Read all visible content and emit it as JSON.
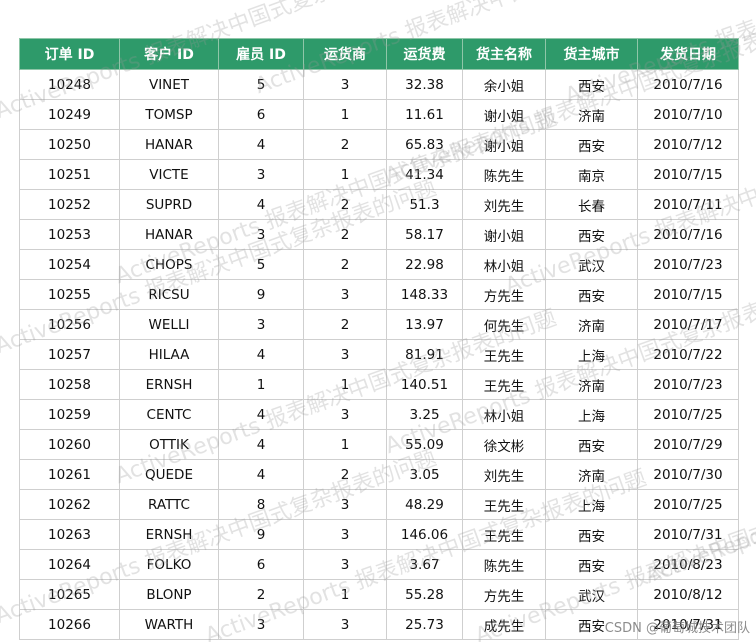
{
  "table": {
    "headers": [
      "订单 ID",
      "客户 ID",
      "雇员 ID",
      "运货商",
      "运货费",
      "货主名称",
      "货主城市",
      "发货日期"
    ],
    "rows": [
      [
        "10248",
        "VINET",
        "5",
        "3",
        "32.38",
        "余小姐",
        "西安",
        "2010/7/16"
      ],
      [
        "10249",
        "TOMSP",
        "6",
        "1",
        "11.61",
        "谢小姐",
        "济南",
        "2010/7/10"
      ],
      [
        "10250",
        "HANAR",
        "4",
        "2",
        "65.83",
        "谢小姐",
        "西安",
        "2010/7/12"
      ],
      [
        "10251",
        "VICTE",
        "3",
        "1",
        "41.34",
        "陈先生",
        "南京",
        "2010/7/15"
      ],
      [
        "10252",
        "SUPRD",
        "4",
        "2",
        "51.3",
        "刘先生",
        "长春",
        "2010/7/11"
      ],
      [
        "10253",
        "HANAR",
        "3",
        "2",
        "58.17",
        "谢小姐",
        "西安",
        "2010/7/16"
      ],
      [
        "10254",
        "CHOPS",
        "5",
        "2",
        "22.98",
        "林小姐",
        "武汉",
        "2010/7/23"
      ],
      [
        "10255",
        "RICSU",
        "9",
        "3",
        "148.33",
        "方先生",
        "西安",
        "2010/7/15"
      ],
      [
        "10256",
        "WELLI",
        "3",
        "2",
        "13.97",
        "何先生",
        "济南",
        "2010/7/17"
      ],
      [
        "10257",
        "HILAA",
        "4",
        "3",
        "81.91",
        "王先生",
        "上海",
        "2010/7/22"
      ],
      [
        "10258",
        "ERNSH",
        "1",
        "1",
        "140.51",
        "王先生",
        "济南",
        "2010/7/23"
      ],
      [
        "10259",
        "CENTC",
        "4",
        "3",
        "3.25",
        "林小姐",
        "上海",
        "2010/7/25"
      ],
      [
        "10260",
        "OTTIK",
        "4",
        "1",
        "55.09",
        "徐文彬",
        "西安",
        "2010/7/29"
      ],
      [
        "10261",
        "QUEDE",
        "4",
        "2",
        "3.05",
        "刘先生",
        "济南",
        "2010/7/30"
      ],
      [
        "10262",
        "RATTC",
        "8",
        "3",
        "48.29",
        "王先生",
        "上海",
        "2010/7/25"
      ],
      [
        "10263",
        "ERNSH",
        "9",
        "3",
        "146.06",
        "王先生",
        "西安",
        "2010/7/31"
      ],
      [
        "10264",
        "FOLKO",
        "6",
        "3",
        "3.67",
        "陈先生",
        "西安",
        "2010/8/23"
      ],
      [
        "10265",
        "BLONP",
        "2",
        "1",
        "55.28",
        "方先生",
        "武汉",
        "2010/8/12"
      ],
      [
        "10266",
        "WARTH",
        "3",
        "3",
        "25.73",
        "成先生",
        "西安",
        "2010/7/31"
      ]
    ]
  },
  "watermark": {
    "text": "ActiveReports 报表解决中国式复杂报表的问题",
    "color": "#969696"
  },
  "credit": "CSDN @葡萄城技术团队",
  "colors": {
    "header_bg": "#2e9a6a",
    "header_text": "#ffffff",
    "grid": "#cfcfcf"
  }
}
